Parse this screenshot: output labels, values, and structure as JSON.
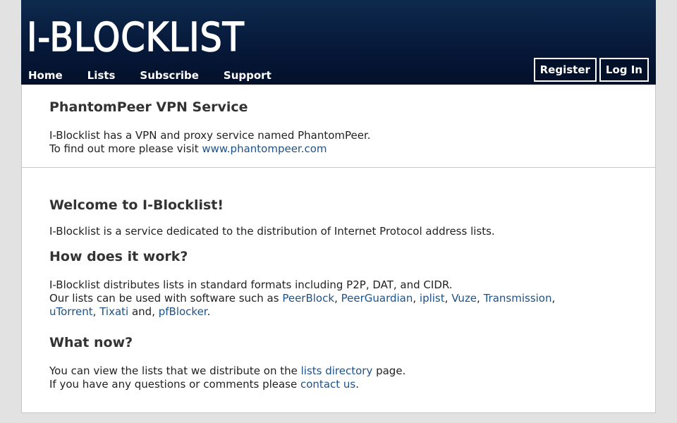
{
  "header": {
    "logo_text": "I-BLOCKLIST",
    "nav": [
      "Home",
      "Lists",
      "Subscribe",
      "Support"
    ],
    "register_label": "Register",
    "login_label": "Log In"
  },
  "vpn": {
    "title": "PhantomPeer VPN Service",
    "line1": "I-Blocklist has a VPN and proxy service named PhantomPeer.",
    "line2_prefix": "To find out more please visit ",
    "link": "www.phantompeer.com"
  },
  "welcome": {
    "title": "Welcome to I-Blocklist!",
    "text": "I-Blocklist is a service dedicated to the distribution of Internet Protocol address lists."
  },
  "how": {
    "title": "How does it work?",
    "line1": "I-Blocklist distributes lists in standard formats including P2P, DAT, and CIDR.",
    "line2_prefix": "Our lists can be used with software such as ",
    "software": [
      "PeerBlock",
      "PeerGuardian",
      "iplist",
      "Vuze",
      "Transmission",
      "uTorrent",
      "Tixati",
      "pfBlocker"
    ],
    "sep_comma": ", ",
    "sep_and": " and, ",
    "end": "."
  },
  "what": {
    "title": "What now?",
    "line1_prefix": "You can view the lists that we distribute on the ",
    "line1_link": "lists directory",
    "line1_suffix": " page.",
    "line2_prefix": "If you have any questions or comments please ",
    "line2_link": "contact us",
    "line2_suffix": "."
  },
  "colors": {
    "header_bg": "#07193a",
    "link": "#1d5289",
    "page_bg": "#e2e2e2"
  }
}
